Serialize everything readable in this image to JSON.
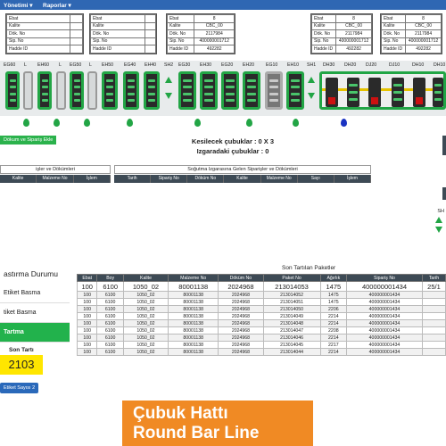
{
  "topbar": {
    "menu1": "Yönetimi ▾",
    "menu2": "Raporlar ▾"
  },
  "cards": [
    {
      "rows": [
        [
          "Ebat",
          ""
        ],
        [
          "Kalite",
          ""
        ],
        [
          "Dök. No",
          ""
        ],
        [
          "Sip. No",
          ""
        ],
        [
          "Hadde ID",
          ""
        ]
      ]
    },
    {
      "rows": [
        [
          "Ebat",
          ""
        ],
        [
          "Kalite",
          ""
        ],
        [
          "Dök. No",
          ""
        ],
        [
          "Sip. No",
          ""
        ],
        [
          "Hadde ID",
          ""
        ]
      ]
    },
    {
      "rows": [
        [
          "Ebat",
          "8"
        ],
        [
          "Kalite",
          "CBC_00"
        ],
        [
          "Dök. No",
          "2117984"
        ],
        [
          "Sip. No",
          "400000001712"
        ],
        [
          "Hadde ID",
          "492282"
        ]
      ]
    },
    {
      "rows": [
        [
          "Ebat",
          "8"
        ],
        [
          "Kalite",
          "CBC_00"
        ],
        [
          "Dök. No",
          "2117984"
        ],
        [
          "Sip. No",
          "400000001712"
        ],
        [
          "Hadde ID",
          "492282"
        ]
      ]
    },
    {
      "rows": [
        [
          "Ebat",
          "8"
        ],
        [
          "Kalite",
          "CBC_00"
        ],
        [
          "Dök. No",
          "2117984"
        ],
        [
          "Sip. No",
          "400000001712"
        ],
        [
          "Hadde ID",
          "492282"
        ]
      ]
    }
  ],
  "line_labels": [
    "EG60",
    "L",
    "EH60",
    "L",
    "EG50",
    "L",
    "EH50",
    "EG40",
    "EH40",
    "SH2",
    "EG30",
    "EH30",
    "EG20",
    "EH20",
    "EG10",
    "EH10",
    "SH1",
    "DH30",
    "DH20",
    "DJ20",
    "DJ10",
    "DH10",
    "DH10"
  ],
  "buttons": {
    "siparis": "Dökum ve Sipariş Ekle",
    "etiket": "Etiket Sayısı 2"
  },
  "kesilecek": "Kesilecek çubuklar : 0 X 3",
  "izgara": "Izgaradaki çubuklar : 0",
  "sections": {
    "left": "işler ve Dökümleri",
    "right": "Soğutma Izgarasına Gelen Siparişler ve Dökümleri"
  },
  "left_cols": [
    "Kalite",
    "Malzeme No",
    "İşlem"
  ],
  "right_cols": [
    "Tarih",
    "Sipariş No",
    "Döküm No",
    "Kalite",
    "Malzeme No",
    "Sayı",
    "İşlem"
  ],
  "side_label": "SH",
  "status_panel": {
    "title": "astırma Durumu",
    "items": [
      "Etiket Basma",
      "tiket Basma",
      "Tartma"
    ],
    "son_tarti_label": "Son Tartı",
    "son_tarti_value": "2103"
  },
  "packets": {
    "title": "Son Tartılan Paketler",
    "columns": [
      "Ebat",
      "Boy",
      "Kalite",
      "Malzeme No",
      "Döküm No",
      "Paket No",
      "Ağırlık",
      "Sipariş No",
      "Tarih"
    ],
    "rows": [
      [
        "100",
        "6100",
        "1050_02",
        "80001138",
        "2024968",
        "213014053",
        "1475",
        "400000001434",
        "25/1"
      ],
      [
        "100",
        "6100",
        "1050_02",
        "80001138",
        "2024968",
        "213014052",
        "1475",
        "400000001434",
        ""
      ],
      [
        "100",
        "6100",
        "1050_02",
        "80001138",
        "2024968",
        "213014051",
        "1475",
        "400000001434",
        ""
      ],
      [
        "100",
        "6100",
        "1050_02",
        "80001138",
        "2024968",
        "213014050",
        "2206",
        "400000001434",
        ""
      ],
      [
        "100",
        "6100",
        "1050_02",
        "80001138",
        "2024968",
        "213014049",
        "2214",
        "400000001434",
        ""
      ],
      [
        "100",
        "6100",
        "1050_02",
        "80001138",
        "2024968",
        "213014048",
        "2214",
        "400000001434",
        ""
      ],
      [
        "100",
        "6100",
        "1050_02",
        "80001138",
        "2024968",
        "213014047",
        "2208",
        "400000001434",
        ""
      ],
      [
        "100",
        "6100",
        "1050_02",
        "80001138",
        "2024968",
        "213014046",
        "2214",
        "400000001434",
        ""
      ],
      [
        "100",
        "6100",
        "1050_02",
        "80001138",
        "2024968",
        "213014045",
        "2217",
        "400000001434",
        ""
      ],
      [
        "100",
        "6100",
        "1050_02",
        "80001138",
        "2024968",
        "213014044",
        "2214",
        "400000001434",
        ""
      ]
    ]
  },
  "overlay": {
    "line1": "Çubuk Hattı",
    "line2": "Round Bar Line"
  },
  "colors": {
    "topbar": "#2f67b3",
    "green": "#22a545",
    "red": "#cc1111",
    "yellow": "#ffe600",
    "orange": "#f08a24"
  }
}
